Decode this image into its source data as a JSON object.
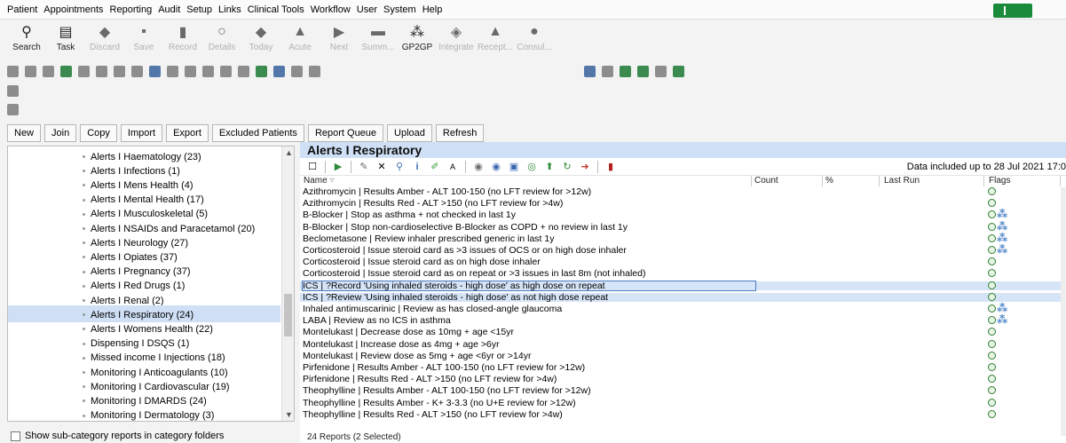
{
  "menu": [
    "Patient",
    "Appointments",
    "Reporting",
    "Audit",
    "Setup",
    "Links",
    "Clinical Tools",
    "Workflow",
    "User",
    "System",
    "Help"
  ],
  "toolbar": [
    {
      "label": "Search",
      "icon": "search-icon",
      "enabled": true
    },
    {
      "label": "Task",
      "icon": "task-icon",
      "enabled": true
    },
    {
      "label": "Discard",
      "icon": "discard-icon",
      "enabled": false
    },
    {
      "label": "Save",
      "icon": "save-icon",
      "enabled": false
    },
    {
      "label": "Record",
      "icon": "record-icon",
      "enabled": false
    },
    {
      "label": "Details",
      "icon": "details-icon",
      "enabled": false
    },
    {
      "label": "Today",
      "icon": "today-icon",
      "enabled": false
    },
    {
      "label": "Acute",
      "icon": "acute-icon",
      "enabled": false
    },
    {
      "label": "Next",
      "icon": "next-icon",
      "enabled": false
    },
    {
      "label": "Summ...",
      "icon": "summary-icon",
      "enabled": false
    },
    {
      "label": "GP2GP",
      "icon": "gp2gp-icon",
      "enabled": true
    },
    {
      "label": "Integrate",
      "icon": "integrate-icon",
      "enabled": false
    },
    {
      "label": "Recept...",
      "icon": "reception-icon",
      "enabled": false
    },
    {
      "label": "Consul...",
      "icon": "consultation-icon",
      "enabled": false
    }
  ],
  "buttons": [
    "New",
    "Join",
    "Copy",
    "Import",
    "Export",
    "Excluded Patients",
    "Report Queue",
    "Upload",
    "Refresh"
  ],
  "tree": [
    "Alerts I Haematology (23)",
    "Alerts I Infections (1)",
    "Alerts I Mens Health (4)",
    "Alerts I Mental Health (17)",
    "Alerts I Musculoskeletal (5)",
    "Alerts I NSAIDs and Paracetamol (20)",
    "Alerts I Neurology (27)",
    "Alerts I Opiates (37)",
    "Alerts I Pregnancy (37)",
    "Alerts I Red Drugs (1)",
    "Alerts I Renal (2)",
    "Alerts I Respiratory (24)",
    "Alerts I Womens Health (22)",
    "Dispensing I DSQS (1)",
    "Missed income I Injections (18)",
    "Monitoring I Anticoagulants (10)",
    "Monitoring I Cardiovascular (19)",
    "Monitoring I DMARDS (24)",
    "Monitoring I Dermatology (3)"
  ],
  "tree_selected_index": 11,
  "left_footer": "Show sub-category reports in category folders",
  "panel": {
    "title": "Alerts I Respiratory",
    "data_info": "Data included up to 28 Jul 2021 17:0",
    "columns": [
      "Name",
      "Count",
      "%",
      "Last Run",
      "Flags"
    ],
    "footer": "24 Reports (2 Selected)"
  },
  "reports": [
    {
      "name": "Azithromycin | Results Amber - ALT 100-150 (no LFT review for >12w)",
      "extra_flag": false,
      "selected": false
    },
    {
      "name": "Azithromycin | Results Red - ALT >150 (no LFT review for >4w)",
      "extra_flag": false,
      "selected": false
    },
    {
      "name": "B-Blocker | Stop as asthma + not checked in last 1y",
      "extra_flag": true,
      "selected": false
    },
    {
      "name": "B-Blocker | Stop non-cardioselective B-Blocker as COPD + no review in last 1y",
      "extra_flag": true,
      "selected": false
    },
    {
      "name": "Beclometasone | Review inhaler prescribed generic in last 1y",
      "extra_flag": true,
      "selected": false
    },
    {
      "name": "Corticosteroid | Issue steroid card as >3 issues of OCS or on high dose inhaler",
      "extra_flag": true,
      "selected": false
    },
    {
      "name": "Corticosteroid | Issue steroid card as on high dose inhaler",
      "extra_flag": false,
      "selected": false
    },
    {
      "name": "Corticosteroid | Issue steroid card as on repeat or >3 issues in last 8m (not inhaled)",
      "extra_flag": false,
      "selected": false
    },
    {
      "name": "ICS | ?Record 'Using inhaled steroids - high dose' as high dose on repeat",
      "extra_flag": false,
      "selected": true
    },
    {
      "name": "ICS | ?Review 'Using inhaled steroids - high dose' as not high dose repeat",
      "extra_flag": false,
      "selected": true
    },
    {
      "name": "Inhaled antimuscarinic | Review as has closed-angle glaucoma",
      "extra_flag": true,
      "selected": false
    },
    {
      "name": "LABA | Review as no ICS in asthma",
      "extra_flag": true,
      "selected": false
    },
    {
      "name": "Montelukast | Decrease dose as 10mg + age <15yr",
      "extra_flag": false,
      "selected": false
    },
    {
      "name": "Montelukast | Increase dose as 4mg + age >6yr",
      "extra_flag": false,
      "selected": false
    },
    {
      "name": "Montelukast | Review dose as 5mg + age <6yr or >14yr",
      "extra_flag": false,
      "selected": false
    },
    {
      "name": "Pirfenidone | Results Amber - ALT 100-150 (no LFT review for >12w)",
      "extra_flag": false,
      "selected": false
    },
    {
      "name": "Pirfenidone | Results Red - ALT >150 (no LFT review for >4w)",
      "extra_flag": false,
      "selected": false
    },
    {
      "name": "Theophylline | Results Amber - ALT 100-150 (no LFT review for >12w)",
      "extra_flag": false,
      "selected": false
    },
    {
      "name": "Theophylline | Results Amber - K+ 3-3.3 (no U+E review for >12w)",
      "extra_flag": false,
      "selected": false
    },
    {
      "name": "Theophylline | Results Red - ALT >150 (no LFT review for >4w)",
      "extra_flag": false,
      "selected": false
    }
  ],
  "colors": {
    "selection": "#cfe0f6",
    "flag_green": "#2e7d32",
    "flag_blue": "#4f86c9"
  }
}
